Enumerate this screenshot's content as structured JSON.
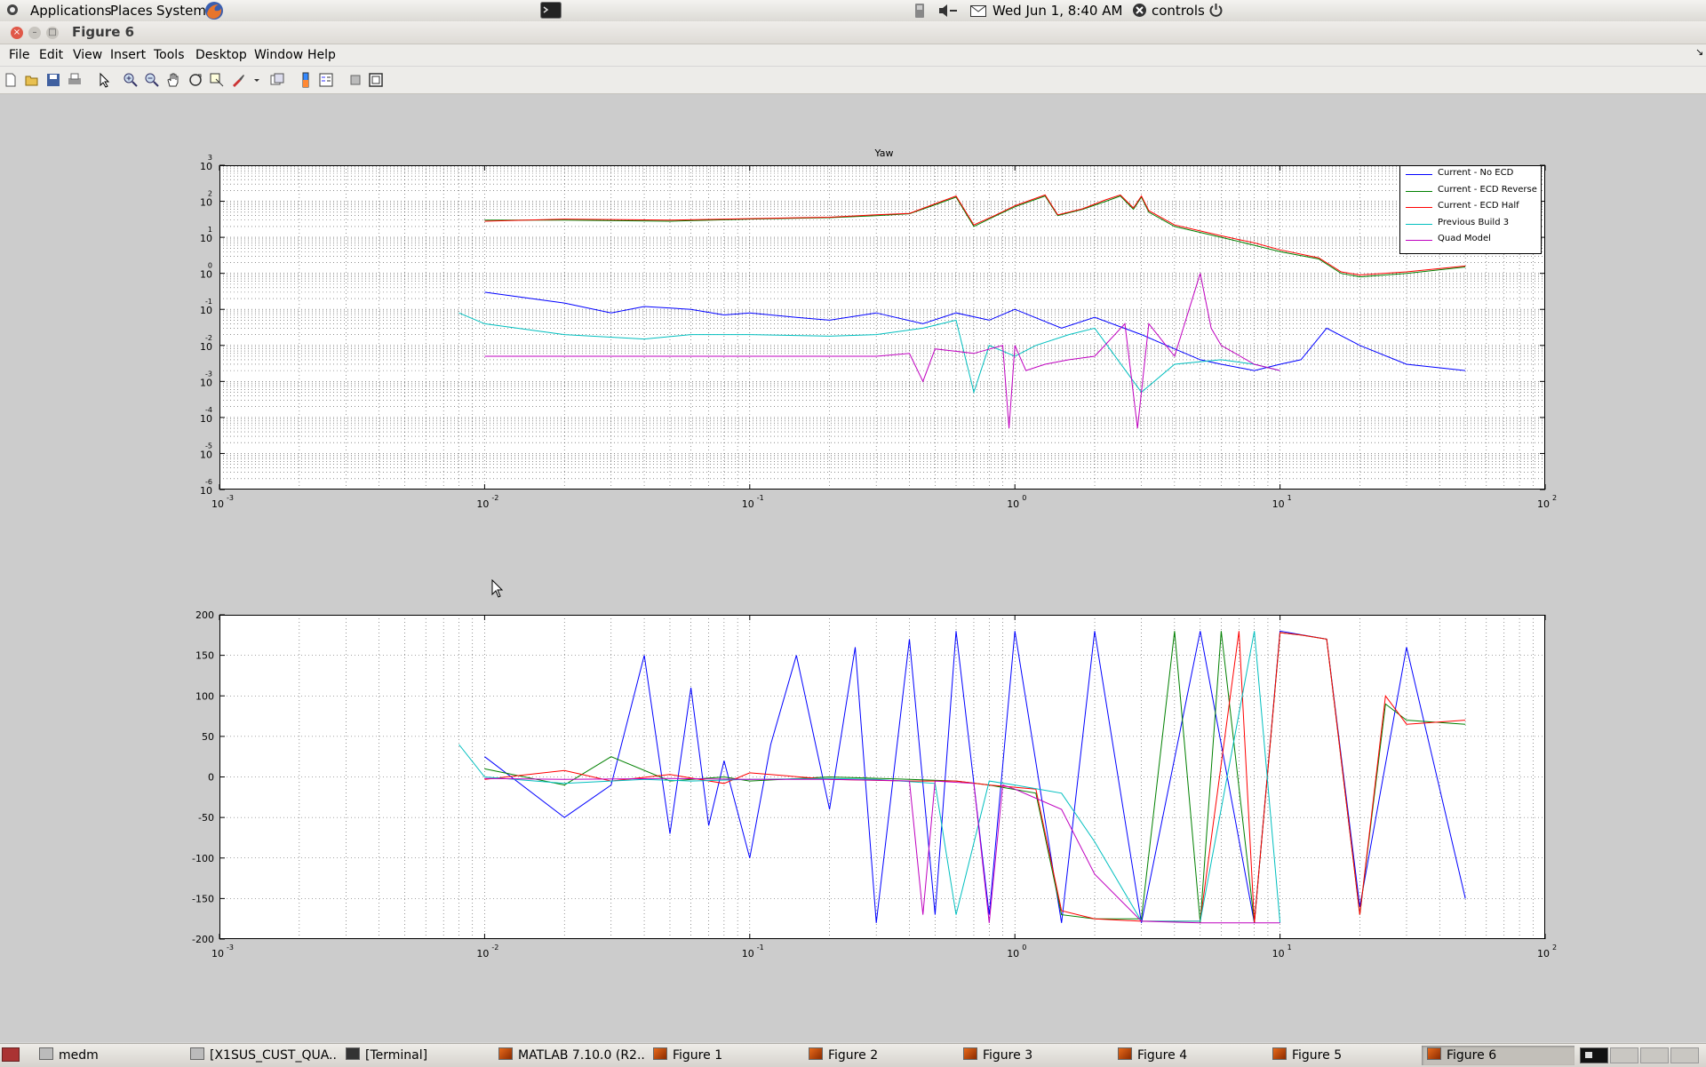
{
  "topbar": {
    "applications": "Applications",
    "places": "Places",
    "system": "System",
    "clock": "Wed Jun  1,  8:40 AM",
    "user": "controls",
    "icons": [
      "firefox-icon",
      "terminal-icon",
      "network-icon",
      "volume-icon",
      "mail-icon",
      "power-icon"
    ]
  },
  "window": {
    "title": "Figure 6"
  },
  "menu": [
    "File",
    "Edit",
    "View",
    "Insert",
    "Tools",
    "Desktop",
    "Window",
    "Help"
  ],
  "toolbar": [
    "new-figure-icon",
    "open-file-icon",
    "save-icon",
    "print-icon",
    "select-arrow-icon",
    "zoom-in-icon",
    "zoom-out-icon",
    "pan-hand-icon",
    "rotate-3d-icon",
    "data-cursor-icon",
    "brush-icon",
    "brush-dropdown-icon",
    "link-plot-icon",
    "insert-colorbar-icon",
    "insert-legend-icon",
    "hide-plot-tools-icon",
    "show-plot-tools-icon"
  ],
  "colors": {
    "blue": "#0000ff",
    "green": "#008000",
    "red": "#ff0000",
    "cyan": "#00bfbf",
    "magenta": "#bf00bf"
  },
  "chart_data": [
    {
      "type": "line",
      "title": "Yaw",
      "xscale": "log",
      "yscale": "log",
      "xlim": [
        0.001,
        100
      ],
      "ylim": [
        1e-06,
        1000
      ],
      "x_tick_bases": [
        "10",
        "10",
        "10",
        "10",
        "10",
        "10"
      ],
      "x_tick_exponents": [
        "-3",
        "-2",
        "-1",
        "0",
        "1",
        "2"
      ],
      "y_tick_bases": [
        "10",
        "10",
        "10",
        "10",
        "10",
        "10",
        "10",
        "10",
        "10",
        "10"
      ],
      "y_tick_exponents": [
        "3",
        "2",
        "1",
        "0",
        "-1",
        "-2",
        "-3",
        "-4",
        "-5",
        "-6"
      ],
      "grid": true,
      "legend_position": "top-right",
      "series": [
        {
          "name": "Current - No ECD",
          "color": "#0000ff",
          "x": [
            0.01,
            0.02,
            0.03,
            0.04,
            0.06,
            0.08,
            0.1,
            0.15,
            0.2,
            0.3,
            0.45,
            0.6,
            0.8,
            1.0,
            1.5,
            2,
            3,
            4,
            5,
            6,
            8,
            10,
            12,
            15,
            20,
            30,
            50
          ],
          "y": [
            0.3,
            0.15,
            0.08,
            0.12,
            0.1,
            0.07,
            0.08,
            0.06,
            0.05,
            0.08,
            0.04,
            0.08,
            0.05,
            0.1,
            0.03,
            0.06,
            0.02,
            0.008,
            0.004,
            0.003,
            0.002,
            0.003,
            0.004,
            0.03,
            0.01,
            0.003,
            0.002
          ]
        },
        {
          "name": "Current - ECD Reverse",
          "color": "#008000",
          "x": [
            0.01,
            0.02,
            0.05,
            0.1,
            0.2,
            0.3,
            0.4,
            0.5,
            0.6,
            0.7,
            0.85,
            1.0,
            1.3,
            1.45,
            1.8,
            2.2,
            2.5,
            2.8,
            3.0,
            3.2,
            4,
            6,
            8,
            10,
            14,
            17,
            20,
            30,
            50
          ],
          "y": [
            30,
            30,
            28,
            32,
            35,
            40,
            45,
            80,
            130,
            20,
            40,
            70,
            140,
            40,
            60,
            100,
            140,
            60,
            130,
            50,
            20,
            10,
            6,
            4,
            2.5,
            1,
            0.8,
            1,
            1.5
          ]
        },
        {
          "name": "Current - ECD Half",
          "color": "#ff0000",
          "x": [
            0.01,
            0.02,
            0.05,
            0.1,
            0.2,
            0.3,
            0.4,
            0.5,
            0.6,
            0.7,
            0.85,
            1.0,
            1.3,
            1.45,
            1.8,
            2.2,
            2.5,
            2.8,
            3.0,
            3.2,
            4,
            6,
            8,
            10,
            14,
            17,
            20,
            30,
            50
          ],
          "y": [
            28,
            32,
            30,
            33,
            36,
            42,
            46,
            85,
            140,
            22,
            42,
            75,
            150,
            42,
            62,
            110,
            150,
            65,
            140,
            55,
            22,
            11,
            7,
            4.5,
            2.7,
            1.1,
            0.9,
            1.1,
            1.6
          ]
        },
        {
          "name": "Previous Build 3",
          "color": "#00bfbf",
          "x": [
            0.008,
            0.01,
            0.02,
            0.04,
            0.06,
            0.1,
            0.2,
            0.3,
            0.45,
            0.6,
            0.7,
            0.8,
            1.0,
            1.2,
            1.6,
            2,
            3,
            4,
            6,
            8,
            10
          ],
          "y": [
            0.08,
            0.04,
            0.02,
            0.015,
            0.02,
            0.02,
            0.018,
            0.02,
            0.03,
            0.05,
            0.0005,
            0.01,
            0.005,
            0.01,
            0.02,
            0.03,
            0.0005,
            0.003,
            0.004,
            0.003,
            0.002
          ]
        },
        {
          "name": "Quad Model",
          "color": "#bf00bf",
          "x": [
            0.01,
            0.02,
            0.05,
            0.1,
            0.2,
            0.3,
            0.4,
            0.45,
            0.5,
            0.7,
            0.9,
            0.95,
            1.0,
            1.1,
            1.3,
            1.6,
            2,
            2.6,
            2.9,
            3.2,
            4,
            5,
            5.5,
            6,
            8,
            10
          ],
          "y": [
            0.005,
            0.005,
            0.005,
            0.005,
            0.005,
            0.005,
            0.006,
            0.001,
            0.008,
            0.006,
            0.01,
            5e-05,
            0.01,
            0.002,
            0.003,
            0.004,
            0.005,
            0.04,
            5e-05,
            0.04,
            0.005,
            1,
            0.03,
            0.01,
            0.003,
            0.002
          ]
        }
      ]
    },
    {
      "type": "line",
      "title": "",
      "xscale": "log",
      "xlim": [
        0.001,
        100
      ],
      "ylim": [
        -200,
        200
      ],
      "x_tick_bases": [
        "10",
        "10",
        "10",
        "10",
        "10",
        "10"
      ],
      "x_tick_exponents": [
        "-3",
        "-2",
        "-1",
        "0",
        "1",
        "2"
      ],
      "y_ticks": [
        "200",
        "150",
        "100",
        "50",
        "0",
        "-50",
        "-100",
        "-150",
        "-200"
      ],
      "grid": true,
      "series": [
        {
          "color": "#0000ff",
          "x": [
            0.01,
            0.02,
            0.03,
            0.04,
            0.05,
            0.06,
            0.07,
            0.08,
            0.1,
            0.12,
            0.15,
            0.2,
            0.25,
            0.3,
            0.4,
            0.5,
            0.6,
            0.8,
            1,
            1.5,
            2,
            3,
            5,
            8,
            10,
            15,
            20,
            30,
            50
          ],
          "y": [
            25,
            -50,
            -10,
            150,
            -70,
            110,
            -60,
            20,
            -100,
            40,
            150,
            -40,
            160,
            -180,
            170,
            -170,
            180,
            -170,
            180,
            -180,
            180,
            -180,
            180,
            -180,
            180,
            170,
            -160,
            160,
            -150
          ]
        },
        {
          "color": "#008000",
          "x": [
            0.01,
            0.02,
            0.03,
            0.05,
            0.08,
            0.1,
            0.2,
            0.4,
            0.6,
            0.8,
            1.2,
            1.5,
            2,
            3,
            4,
            5,
            6,
            8,
            10,
            12,
            15,
            20,
            25,
            30,
            50
          ],
          "y": [
            10,
            -10,
            25,
            -5,
            0,
            -5,
            0,
            -3,
            -5,
            -10,
            -20,
            -170,
            -175,
            -175,
            180,
            -180,
            180,
            -180,
            178,
            175,
            170,
            -170,
            90,
            70,
            65
          ]
        },
        {
          "color": "#ff0000",
          "x": [
            0.01,
            0.02,
            0.03,
            0.05,
            0.08,
            0.1,
            0.2,
            0.4,
            0.6,
            0.8,
            1.2,
            1.5,
            2,
            3,
            4,
            5,
            7,
            8,
            10,
            12,
            15,
            20,
            25,
            30,
            50
          ],
          "y": [
            -3,
            8,
            -5,
            3,
            -8,
            5,
            -3,
            -5,
            -5,
            -10,
            -15,
            -165,
            -175,
            -178,
            -178,
            -178,
            180,
            -180,
            178,
            175,
            170,
            -170,
            100,
            65,
            70
          ]
        },
        {
          "color": "#00bfbf",
          "x": [
            0.008,
            0.01,
            0.02,
            0.04,
            0.06,
            0.1,
            0.2,
            0.3,
            0.5,
            0.6,
            0.8,
            1.0,
            1.5,
            2,
            3,
            5,
            8,
            10
          ],
          "y": [
            40,
            0,
            -8,
            -3,
            -5,
            -3,
            -2,
            -3,
            -8,
            -170,
            -5,
            -10,
            -20,
            -80,
            -178,
            -178,
            180,
            -180
          ]
        },
        {
          "color": "#bf00bf",
          "x": [
            0.01,
            0.02,
            0.05,
            0.1,
            0.2,
            0.3,
            0.4,
            0.45,
            0.5,
            0.7,
            0.8,
            0.9,
            1.0,
            1.5,
            2,
            3,
            5,
            8,
            10
          ],
          "y": [
            -2,
            -3,
            -2,
            -3,
            -3,
            -4,
            -5,
            -170,
            -5,
            -8,
            -180,
            -10,
            -15,
            -40,
            -120,
            -178,
            -180,
            -180,
            -180
          ]
        }
      ]
    }
  ],
  "taskbar": [
    {
      "label": "medm",
      "icon": "window-icon"
    },
    {
      "label": "[X1SUS_CUST_QUA...",
      "icon": "window-icon"
    },
    {
      "label": "[Terminal]",
      "icon": "terminal-icon"
    },
    {
      "label": "MATLAB  7.10.0 (R2...",
      "icon": "matlab-icon"
    },
    {
      "label": "Figure 1",
      "icon": "matlab-icon"
    },
    {
      "label": "Figure 2",
      "icon": "matlab-icon"
    },
    {
      "label": "Figure 3",
      "icon": "matlab-icon"
    },
    {
      "label": "Figure 4",
      "icon": "matlab-icon"
    },
    {
      "label": "Figure 5",
      "icon": "matlab-icon"
    },
    {
      "label": "Figure 6",
      "icon": "matlab-icon"
    }
  ]
}
